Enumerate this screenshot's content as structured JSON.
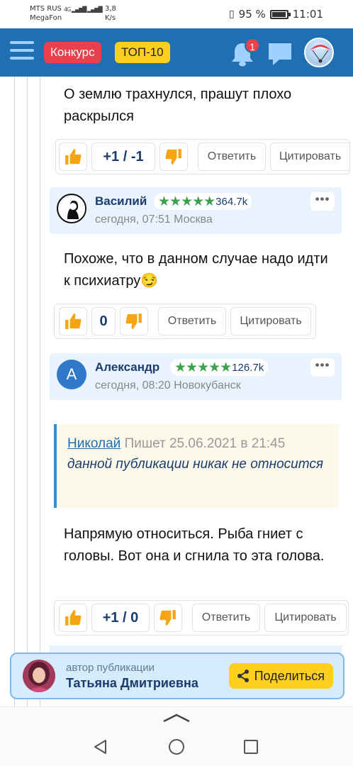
{
  "status_bar": {
    "carrier1": "MTS RUS",
    "carrier2": "MegaFon",
    "signal": "4G",
    "speed_value": "3,8",
    "speed_unit": "K/s",
    "battery": "95 %",
    "battery_level": 0.95,
    "time": "11:01"
  },
  "header": {
    "menu_icon": "hamburger-icon",
    "contest_label": "Конкурс",
    "top_label": "ТОП-10",
    "notifications_count": "1",
    "colors": {
      "bar": "#1f6fb2",
      "contest": "#e8414c",
      "top": "#ffce1f"
    }
  },
  "comments": [
    {
      "text": "О землю трахнулся, прашут плохо раскрылся",
      "score": "+1 / -1",
      "reply_label": "Ответить",
      "quote_label": "Цитировать"
    },
    {
      "user": {
        "name": "Василий",
        "rating": "364.7k",
        "meta": "сегодня, 07:51  Москва",
        "more": "•••"
      },
      "text": "Похоже, что в данном случае надо идти к психиатру😏",
      "score": "0",
      "reply_label": "Ответить",
      "quote_label": "Цитировать"
    },
    {
      "user": {
        "name": "Александр",
        "initial": "А",
        "rating": "126.7k",
        "meta": "сегодня, 08:20  Новокубанск",
        "more": "•••"
      },
      "quote": {
        "author": "Николай",
        "written": "Пишет 25.06.2021 в 21:45",
        "text": "данной публикации никак не относится"
      },
      "text": "Напрямую относиться. Рыба гниет с головы. Вот она и сгнила то эта голова.",
      "score": "+1 / 0",
      "reply_label": "Ответить",
      "quote_label": "Цитировать"
    }
  ],
  "rating_stars": "★★★★★",
  "author_bar": {
    "caption": "автор публикации",
    "name": "Татьяна Дмитриевна",
    "share_label": "Поделиться"
  }
}
